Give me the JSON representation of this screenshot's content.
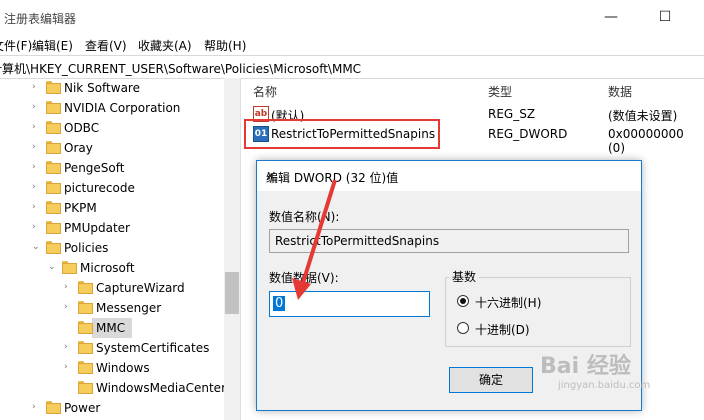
{
  "window": {
    "title": "注册表编辑器",
    "minimize": "—",
    "maximize": "☐"
  },
  "menu": [
    "文件(F)",
    "编辑(E)",
    "查看(V)",
    "收藏夹(A)",
    "帮助(H)"
  ],
  "address": "计算机\\HKEY_CURRENT_USER\\Software\\Policies\\Microsoft\\MMC",
  "tree": [
    {
      "label": "Nik Software"
    },
    {
      "label": "NVIDIA Corporation"
    },
    {
      "label": "ODBC"
    },
    {
      "label": "Oray"
    },
    {
      "label": "PengeSoft"
    },
    {
      "label": "picturecode"
    },
    {
      "label": "PKPM"
    },
    {
      "label": "PMUpdater"
    },
    {
      "label": "Policies"
    },
    {
      "label": "Microsoft"
    },
    {
      "label": "CaptureWizard"
    },
    {
      "label": "Messenger"
    },
    {
      "label": "MMC"
    },
    {
      "label": "SystemCertificates"
    },
    {
      "label": "Windows"
    },
    {
      "label": "WindowsMediaCenter"
    },
    {
      "label": "Power"
    }
  ],
  "list": {
    "headers": {
      "name": "名称",
      "type": "类型",
      "data": "数据"
    },
    "rows": [
      {
        "icon": "ab",
        "name": "(默认)",
        "type": "REG_SZ",
        "data": "(数值未设置)"
      },
      {
        "icon": "01",
        "name": "RestrictToPermittedSnapins",
        "type": "REG_DWORD",
        "data": "0x00000000 (0)"
      }
    ]
  },
  "dialog": {
    "title": "编辑 DWORD (32 位)值",
    "close": "✕",
    "name_label": "数值名称(N):",
    "name_value": "RestrictToPermittedSnapins",
    "data_label": "数值数据(V):",
    "data_value": "0",
    "base_label": "基数",
    "hex_label": "十六进制(H)",
    "dec_label": "十进制(D)",
    "ok": "确定",
    "selected_base": "hex"
  },
  "watermark": {
    "brand": "Bai 经验",
    "url": "jingyan.baidu.com"
  },
  "colors": {
    "highlight": "#e53935",
    "accent": "#0078d7"
  }
}
